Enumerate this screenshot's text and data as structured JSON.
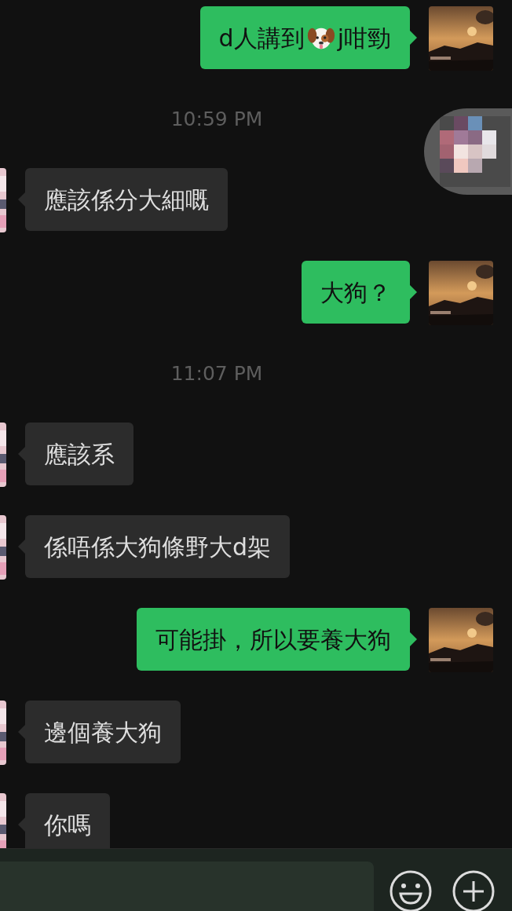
{
  "messages": [
    {
      "kind": "sent",
      "parts": [
        {
          "kind": "text",
          "text": "d人講到"
        },
        {
          "kind": "emoji"
        },
        {
          "kind": "text",
          "text": "j咁勁"
        }
      ]
    },
    {
      "kind": "time",
      "text": "10:59 PM"
    },
    {
      "kind": "received",
      "parts": [
        {
          "kind": "text",
          "text": "應該係分大細嘅"
        }
      ]
    },
    {
      "kind": "sent",
      "parts": [
        {
          "kind": "text",
          "text": "大狗？"
        }
      ]
    },
    {
      "kind": "time",
      "text": "11:07 PM"
    },
    {
      "kind": "received",
      "parts": [
        {
          "kind": "text",
          "text": "應該系"
        }
      ]
    },
    {
      "kind": "received",
      "parts": [
        {
          "kind": "text",
          "text": "係唔係大狗條野大d架"
        }
      ]
    },
    {
      "kind": "sent",
      "parts": [
        {
          "kind": "text",
          "text": "可能掛，所以要養大狗"
        }
      ]
    },
    {
      "kind": "received",
      "parts": [
        {
          "kind": "text",
          "text": "邊個養大狗"
        }
      ]
    },
    {
      "kind": "received",
      "parts": [
        {
          "kind": "text",
          "text": "你嗎"
        }
      ]
    }
  ]
}
